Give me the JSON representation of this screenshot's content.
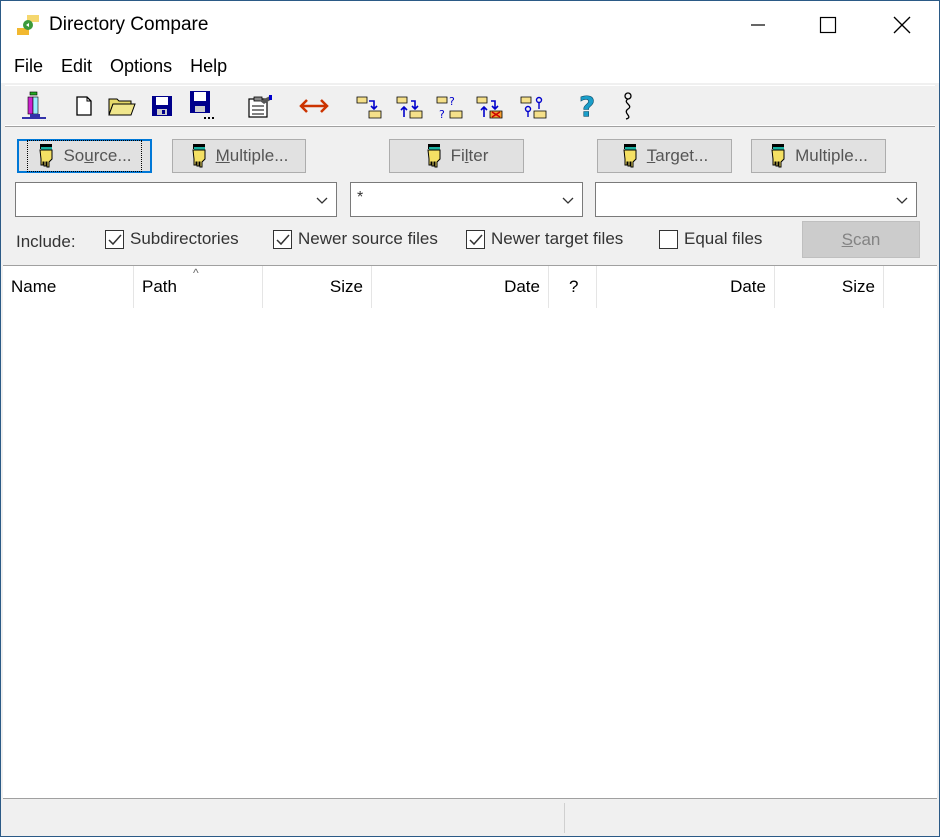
{
  "window": {
    "title": "Directory Compare",
    "app_icon": "directory-compare-icon",
    "controls": {
      "minimize": "minimize-icon",
      "maximize": "maximize-icon",
      "close": "close-icon"
    }
  },
  "menu": [
    "File",
    "Edit",
    "Options",
    "Help"
  ],
  "toolbar": [
    {
      "name": "compare-tool",
      "icon": "compare-tower-icon"
    },
    {
      "name": "new",
      "icon": "new-file-icon"
    },
    {
      "name": "open",
      "icon": "open-folder-icon"
    },
    {
      "name": "save",
      "icon": "save-icon"
    },
    {
      "name": "save-as",
      "icon": "save-as-icon"
    },
    {
      "name": "properties",
      "icon": "properties-icon"
    },
    {
      "name": "swap",
      "icon": "swap-arrows-icon"
    },
    {
      "name": "copy-to-target",
      "icon": "copy-to-target-icon"
    },
    {
      "name": "sync-both",
      "icon": "sync-both-icon"
    },
    {
      "name": "compare-unknown",
      "icon": "compare-unknown-icon"
    },
    {
      "name": "delete-target",
      "icon": "delete-target-icon"
    },
    {
      "name": "link-folders",
      "icon": "link-folders-icon"
    },
    {
      "name": "help",
      "icon": "help-icon"
    },
    {
      "name": "context-help",
      "icon": "context-help-icon"
    }
  ],
  "buttons": {
    "source": {
      "pre": "So",
      "ul": "u",
      "post": "rce..."
    },
    "source_multiple": {
      "pre": "",
      "ul": "M",
      "post": "ultiple..."
    },
    "filter": {
      "pre": "Fi",
      "ul": "l",
      "post": "ter"
    },
    "target": {
      "pre": "",
      "ul": "T",
      "post": "arget..."
    },
    "target_multiple": {
      "pre": "",
      "ul": "",
      "post": "Multiple..."
    },
    "scan": {
      "pre": "",
      "ul": "S",
      "post": "can"
    }
  },
  "combos": {
    "source_path": "",
    "filter": "*",
    "target_path": ""
  },
  "include": {
    "label": "Include:",
    "options": [
      {
        "label": "Subdirectories",
        "checked": true
      },
      {
        "label": "Newer source files",
        "checked": true
      },
      {
        "label": "Newer target files",
        "checked": true
      },
      {
        "label": "Equal files",
        "checked": false
      }
    ]
  },
  "list": {
    "columns": [
      "Name",
      "Path",
      "Size",
      "Date",
      "?",
      "Date",
      "Size"
    ],
    "sorted_column": "Path",
    "rows": []
  },
  "statusbar": {
    "left": "",
    "right": ""
  }
}
